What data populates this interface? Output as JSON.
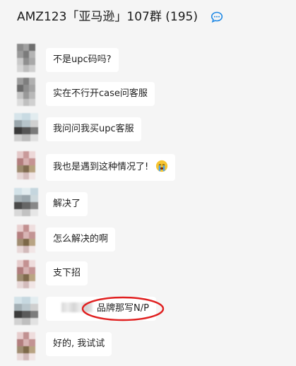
{
  "header": {
    "title": "AMZ123「亚马逊」107群 (195)",
    "chat_icon": "chat-bubble-icon",
    "accent": "#1e88e5"
  },
  "messages": [
    {
      "text": "不是upc码吗?"
    },
    {
      "text": "实在不行开case问客服"
    },
    {
      "text": "我问问我买upc客服"
    },
    {
      "text": "我也是遇到这种情况了!",
      "emoji": "crying-face-icon"
    },
    {
      "text": "解决了"
    },
    {
      "text": "怎么解决的啊"
    },
    {
      "text": "支下招"
    },
    {
      "text": "品牌那写N/P",
      "highlight_color": "#e02020"
    },
    {
      "text": "好的, 我试试"
    }
  ]
}
